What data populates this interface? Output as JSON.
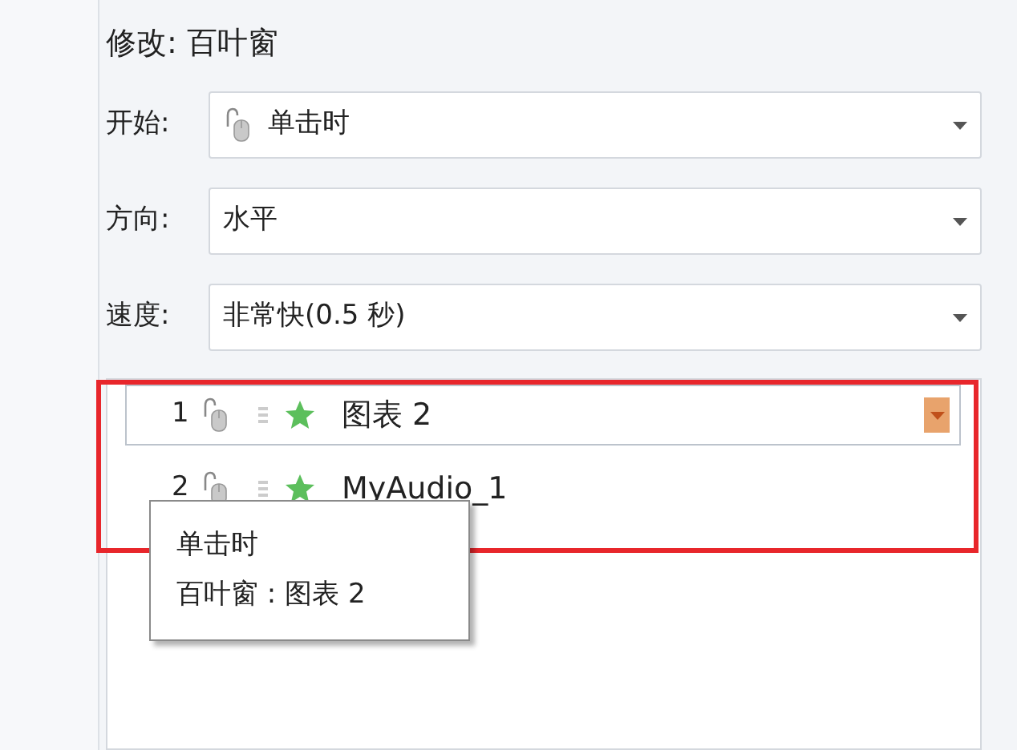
{
  "heading": "修改: 百叶窗",
  "fields": [
    {
      "label": "开始:",
      "value": "单击时",
      "kind": "mouse"
    },
    {
      "label": "方向:",
      "value": "水平",
      "kind": "plain"
    },
    {
      "label": "速度:",
      "value": "非常快(0.5 秒)",
      "kind": "plain"
    }
  ],
  "animations": [
    {
      "number": "1",
      "name": "图表 2",
      "selected": true
    },
    {
      "number": "2",
      "name": "MyAudio_1",
      "selected": false
    }
  ],
  "tooltip": {
    "lines": [
      "单击时",
      "百叶窗 : 图表 2"
    ]
  }
}
